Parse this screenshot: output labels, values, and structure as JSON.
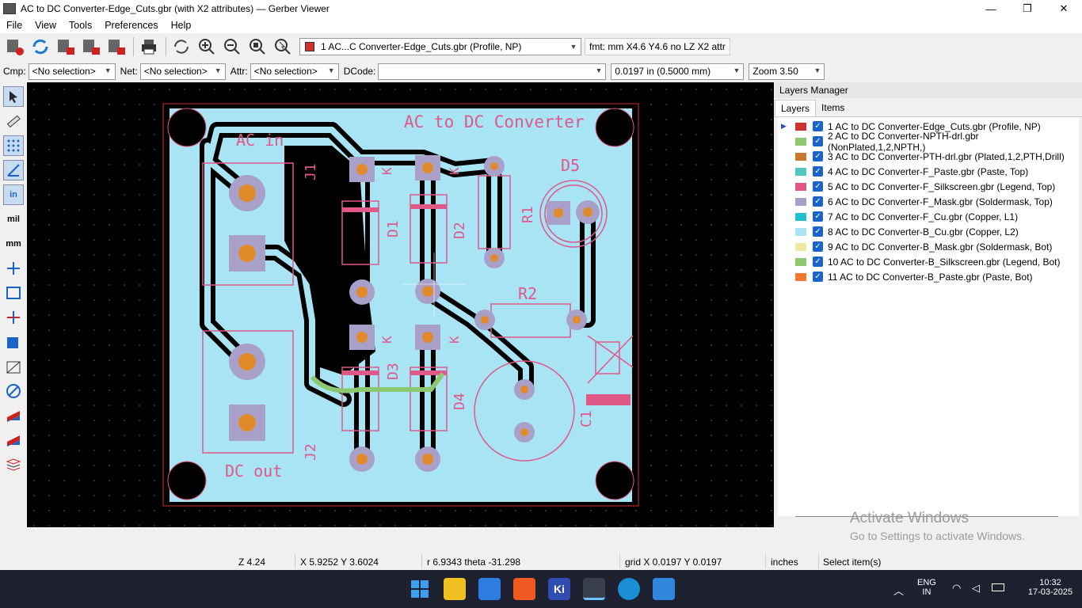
{
  "window": {
    "title": "AC to DC Converter-Edge_Cuts.gbr (with X2 attributes) — Gerber Viewer",
    "minimize": "—",
    "maximize": "❐",
    "close": "✕"
  },
  "menu": [
    "File",
    "View",
    "Tools",
    "Preferences",
    "Help"
  ],
  "toolbar": {
    "layer_selector": "1 AC...C Converter-Edge_Cuts.gbr (Profile, NP)",
    "format_info": "fmt: mm X4.6 Y4.6 no LZ X2 attr"
  },
  "filters": {
    "cmp_label": "Cmp:",
    "cmp_value": "<No selection>",
    "net_label": "Net:",
    "net_value": "<No selection>",
    "attr_label": "Attr:",
    "attr_value": "<No selection>",
    "dcode_label": "DCode:",
    "dcode_value": "",
    "grid_value": "0.0197 in (0.5000 mm)",
    "zoom_value": "Zoom 3.50"
  },
  "board": {
    "title_text": "AC to DC Converter",
    "ac_in": "AC in",
    "dc_out": "DC out",
    "refs": [
      "J1",
      "J2",
      "D1",
      "D2",
      "D3",
      "D4",
      "D5",
      "R1",
      "R2",
      "C1",
      "K",
      "K",
      "K",
      "K"
    ]
  },
  "layers_manager": {
    "title": "Layers Manager",
    "tabs": [
      "Layers",
      "Items"
    ],
    "layers": [
      {
        "label": "1 AC to DC Converter-Edge_Cuts.gbr (Profile, NP)",
        "color": "#d03030"
      },
      {
        "label": "2 AC to DC Converter-NPTH-drl.gbr (NonPlated,1,2,NPTH,)",
        "color": "#8cc870"
      },
      {
        "label": "3 AC to DC Converter-PTH-drl.gbr (Plated,1,2,PTH,Drill)",
        "color": "#c87830"
      },
      {
        "label": "4 AC to DC Converter-F_Paste.gbr (Paste, Top)",
        "color": "#50c8c0"
      },
      {
        "label": "5 AC to DC Converter-F_Silkscreen.gbr (Legend, Top)",
        "color": "#e05888"
      },
      {
        "label": "6 AC to DC Converter-F_Mask.gbr (Soldermask, Top)",
        "color": "#a8a0c8"
      },
      {
        "label": "7 AC to DC Converter-F_Cu.gbr (Copper, L1)",
        "color": "#20c0d0"
      },
      {
        "label": "8 AC to DC Converter-B_Cu.gbr (Copper, L2)",
        "color": "#a8e4f4"
      },
      {
        "label": "9 AC to DC Converter-B_Mask.gbr (Soldermask, Bot)",
        "color": "#f0e8a0"
      },
      {
        "label": "10 AC to DC Converter-B_Silkscreen.gbr (Legend, Bot)",
        "color": "#90c870"
      },
      {
        "label": "11 AC to DC Converter-B_Paste.gbr (Paste, Bot)",
        "color": "#f07830"
      }
    ],
    "watermark_line1": "Activate Windows",
    "watermark_line2": "Go to Settings to activate Windows."
  },
  "status": {
    "zoom": "Z 4.24",
    "xy": "X 5.9252  Y 3.6024",
    "polar": "r 6.9343  theta -31.298",
    "grid": "grid X 0.0197  Y 0.0197",
    "units": "inches",
    "mode": "Select item(s)"
  },
  "taskbar": {
    "lang1": "ENG",
    "lang2": "IN",
    "time": "10:32",
    "date": "17-03-2025"
  }
}
